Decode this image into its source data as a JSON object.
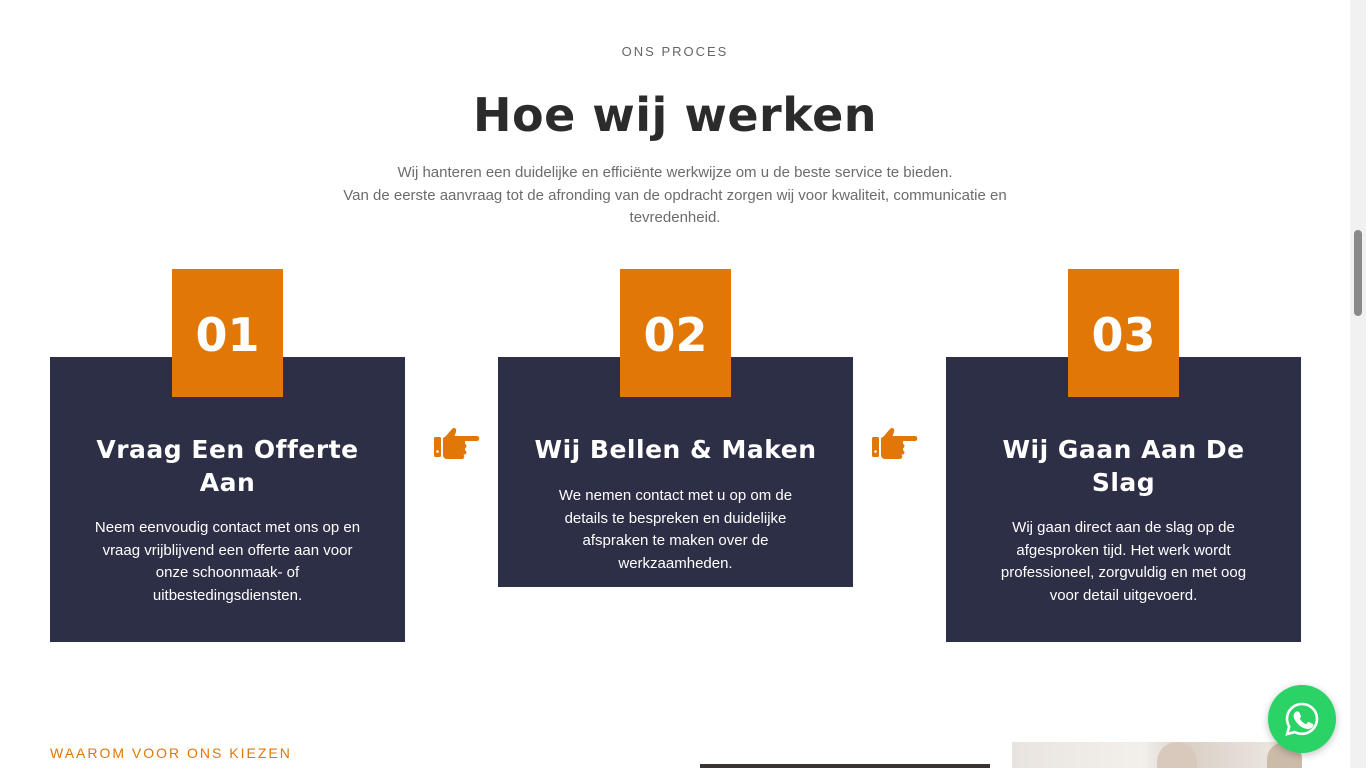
{
  "process": {
    "eyebrow": "ONS PROCES",
    "title": "Hoe wij werken",
    "intro_line1": "Wij hanteren een duidelijke en efficiënte werkwijze om u de beste service te bieden.",
    "intro_line2": "Van de eerste aanvraag tot de afronding van de opdracht zorgen wij voor kwaliteit, communicatie en tevredenheid."
  },
  "steps": [
    {
      "number": "01",
      "title": "Vraag Een Offerte Aan",
      "text": "Neem eenvoudig contact met ons op en vraag vrijblijvend een offerte aan voor onze schoonmaak- of uitbestedingsdiensten."
    },
    {
      "number": "02",
      "title": "Wij Bellen & Maken",
      "text": "We nemen contact met u op om de details te bespreken en duidelijke afspraken te maken over de werkzaamheden."
    },
    {
      "number": "03",
      "title": "Wij Gaan Aan De Slag",
      "text": "Wij gaan direct aan de slag op de afgesproken tijd. Het werk wordt professioneel, zorgvuldig en met oog voor detail uitgevoerd."
    }
  ],
  "icons": {
    "arrow": "pointing-hand-right-icon",
    "whatsapp": "whatsapp-icon"
  },
  "why": {
    "eyebrow": "WAAROM VOOR ONS KIEZEN"
  },
  "colors": {
    "accent": "#e07706",
    "card_bg": "#2c2f45",
    "whatsapp": "#2bd366"
  }
}
